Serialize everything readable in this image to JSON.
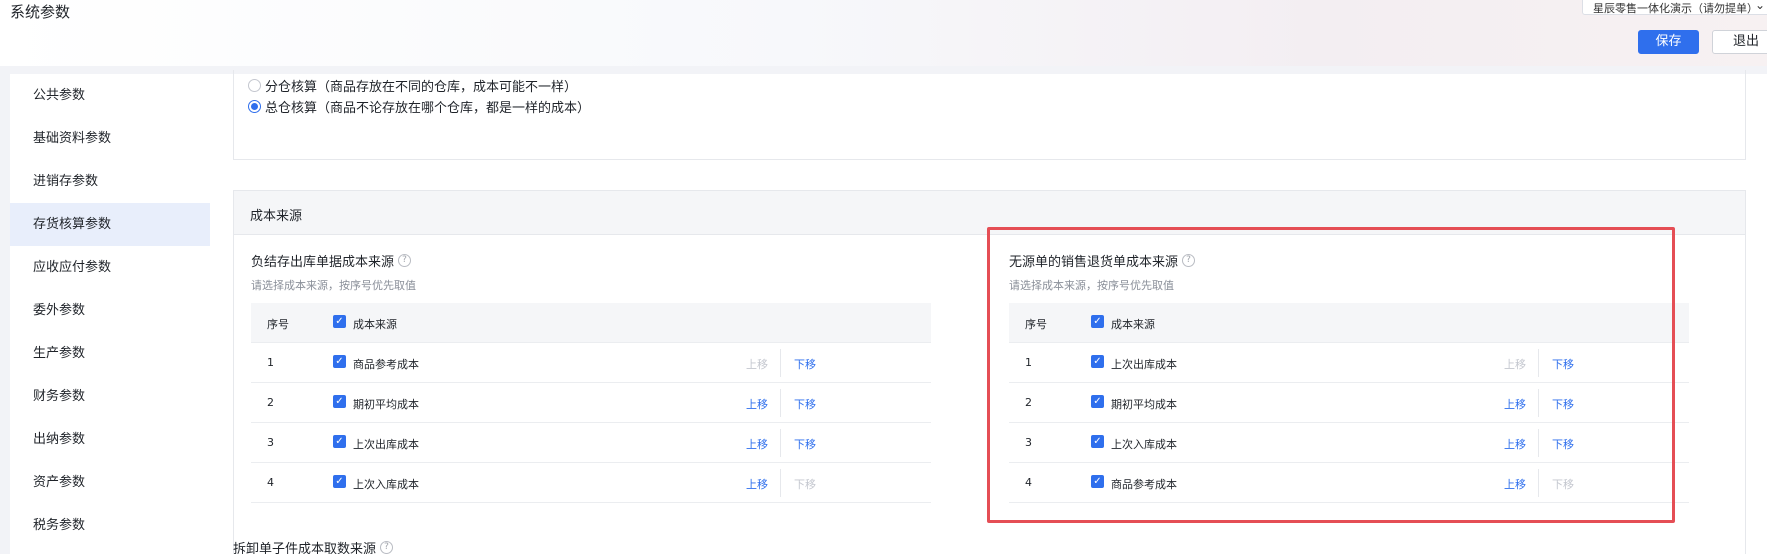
{
  "header": {
    "title": "系统参数",
    "account_label": "星辰零售一体化演示（请勿提单）",
    "save_label": "保存",
    "exit_label": "退出"
  },
  "sidebar": {
    "items": [
      {
        "label": "公共参数",
        "active": false
      },
      {
        "label": "基础资料参数",
        "active": false
      },
      {
        "label": "进销存参数",
        "active": false
      },
      {
        "label": "存货核算参数",
        "active": true
      },
      {
        "label": "应收应付参数",
        "active": false
      },
      {
        "label": "委外参数",
        "active": false
      },
      {
        "label": "生产参数",
        "active": false
      },
      {
        "label": "财务参数",
        "active": false
      },
      {
        "label": "出纳参数",
        "active": false
      },
      {
        "label": "资产参数",
        "active": false
      },
      {
        "label": "税务参数",
        "active": false
      }
    ]
  },
  "accounting": {
    "options": [
      {
        "label": "分仓核算（商品存放在不同的仓库，成本可能不一样）",
        "checked": false
      },
      {
        "label": "总仓核算（商品不论存放在哪个仓库，都是一样的成本）",
        "checked": true
      }
    ]
  },
  "cost_source": {
    "section_title": "成本来源",
    "hint": "请选择成本来源，按序号优先取值",
    "col_no": "序号",
    "col_source": "成本来源",
    "up_label": "上移",
    "down_label": "下移",
    "negative_stock": {
      "title": "负结存出库单据成本来源",
      "rows": [
        {
          "no": "1",
          "name": "商品参考成本",
          "up_enabled": false,
          "down_enabled": true
        },
        {
          "no": "2",
          "name": "期初平均成本",
          "up_enabled": true,
          "down_enabled": true
        },
        {
          "no": "3",
          "name": "上次出库成本",
          "up_enabled": true,
          "down_enabled": true
        },
        {
          "no": "4",
          "name": "上次入库成本",
          "up_enabled": true,
          "down_enabled": false
        }
      ]
    },
    "no_source_return": {
      "title": "无源单的销售退货单成本来源",
      "rows": [
        {
          "no": "1",
          "name": "上次出库成本",
          "up_enabled": false,
          "down_enabled": true
        },
        {
          "no": "2",
          "name": "期初平均成本",
          "up_enabled": true,
          "down_enabled": true
        },
        {
          "no": "3",
          "name": "上次入库成本",
          "up_enabled": true,
          "down_enabled": true
        },
        {
          "no": "4",
          "name": "商品参考成本",
          "up_enabled": true,
          "down_enabled": false
        }
      ]
    },
    "disassembly_title": "拆卸单子件成本取数来源"
  },
  "icons": {
    "help": "question-circle-icon",
    "check": "checkbox-checked-icon",
    "chevron": "chevron-down-icon"
  },
  "colors": {
    "primary": "#2f6fed",
    "highlight": "#e54e55",
    "disabled": "#c4c7cf"
  }
}
